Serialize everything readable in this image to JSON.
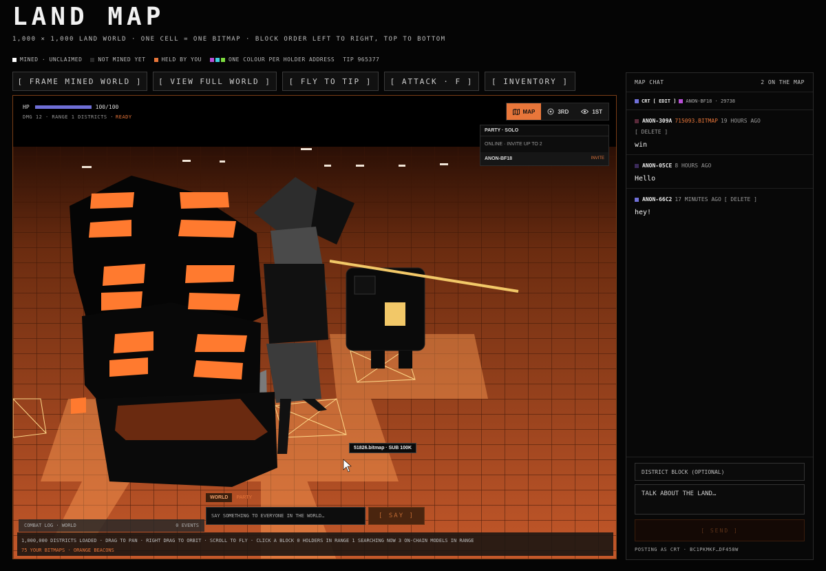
{
  "header": {
    "title": "LAND MAP",
    "subtitle": "1,000 × 1,000 LAND WORLD · ONE CELL = ONE BITMAP · BLOCK ORDER LEFT TO RIGHT, TOP TO BOTTOM"
  },
  "legend": {
    "mined": "MINED · UNCLAIMED",
    "not_mined": "NOT MINED YET",
    "held": "HELD BY YOU",
    "colour_per_holder": "ONE COLOUR PER HOLDER ADDRESS",
    "tip": "TIP 965377",
    "colors": {
      "mined": "#ffffff",
      "not_mined": "#2a2a2a",
      "held": "#e8763a",
      "holder_a": "#b84fd6",
      "holder_b": "#3fd0e0",
      "holder_c": "#7ddc3f"
    }
  },
  "toolbar": {
    "frame_mined": "[ FRAME MINED WORLD ]",
    "view_full": "[ VIEW FULL WORLD ]",
    "fly_tip": "[ FLY TO TIP ]",
    "attack": "[ ATTACK · F ]",
    "inventory": "[ INVENTORY ]"
  },
  "hud": {
    "hp_label": "HP",
    "hp_value": "100/100",
    "hp_fraction": 1.0,
    "stats": "DMG 12 · RANGE 1 DISTRICTS ·",
    "ready": "READY"
  },
  "view_modes": {
    "map": "MAP",
    "third": "3RD",
    "first": "1ST",
    "active": "map"
  },
  "party": {
    "title": "PARTY · SOLO",
    "status": "ONLINE · INVITE UP TO 2",
    "member": "ANON-BF18",
    "invite": "INVITE"
  },
  "block_tooltip": "51826.bitmap · SUB 100K",
  "world_chat": {
    "tab_world": "WORLD",
    "tab_party": "PARTY",
    "placeholder": "SAY SOMETHING TO EVERYONE IN THE WORLD…",
    "say": "[ SAY ]"
  },
  "combat_log": {
    "label": "COMBAT LOG · WORLD",
    "events": "0 EVENTS"
  },
  "status_bar": {
    "line1": "1,000,000 DISTRICTS LOADED · DRAG TO PAN · RIGHT DRAG TO ORBIT · SCROLL TO FLY · CLICK A BLOCK  0 HOLDERS IN RANGE  1 SEARCHING NOW  3 ON-CHAIN MODELS IN RANGE",
    "line2": "75 YOUR BITMAPS · ORANGE BEACONS"
  },
  "chat": {
    "title": "MAP CHAT",
    "online": "2 ON THE MAP",
    "me": {
      "name": "CRT",
      "edit": "[ EDIT ]",
      "id": "ANON-BF18 · 29738"
    },
    "messages": [
      {
        "author": "ANON-309A",
        "link": "715093.BITMAP",
        "time": "19 HOURS AGO",
        "delete": "[ DELETE ]",
        "text": "win",
        "color": "#5a2a3a"
      },
      {
        "author": "ANON-05CE",
        "link": "",
        "time": "8 HOURS AGO",
        "delete": "",
        "text": "Hello",
        "color": "#3b2a5a"
      },
      {
        "author": "ANON-66C2",
        "link": "",
        "time": "17 MINUTES AGO",
        "delete": "[ DELETE ]",
        "text": "hey!",
        "color": "#7070d8"
      }
    ],
    "district_placeholder": "DISTRICT BLOCK (OPTIONAL)",
    "talk_placeholder": "TALK ABOUT THE LAND…",
    "send": "[ SEND ]",
    "posting_as": "POSTING AS CRT · BC1PKMKF…DF458W"
  }
}
